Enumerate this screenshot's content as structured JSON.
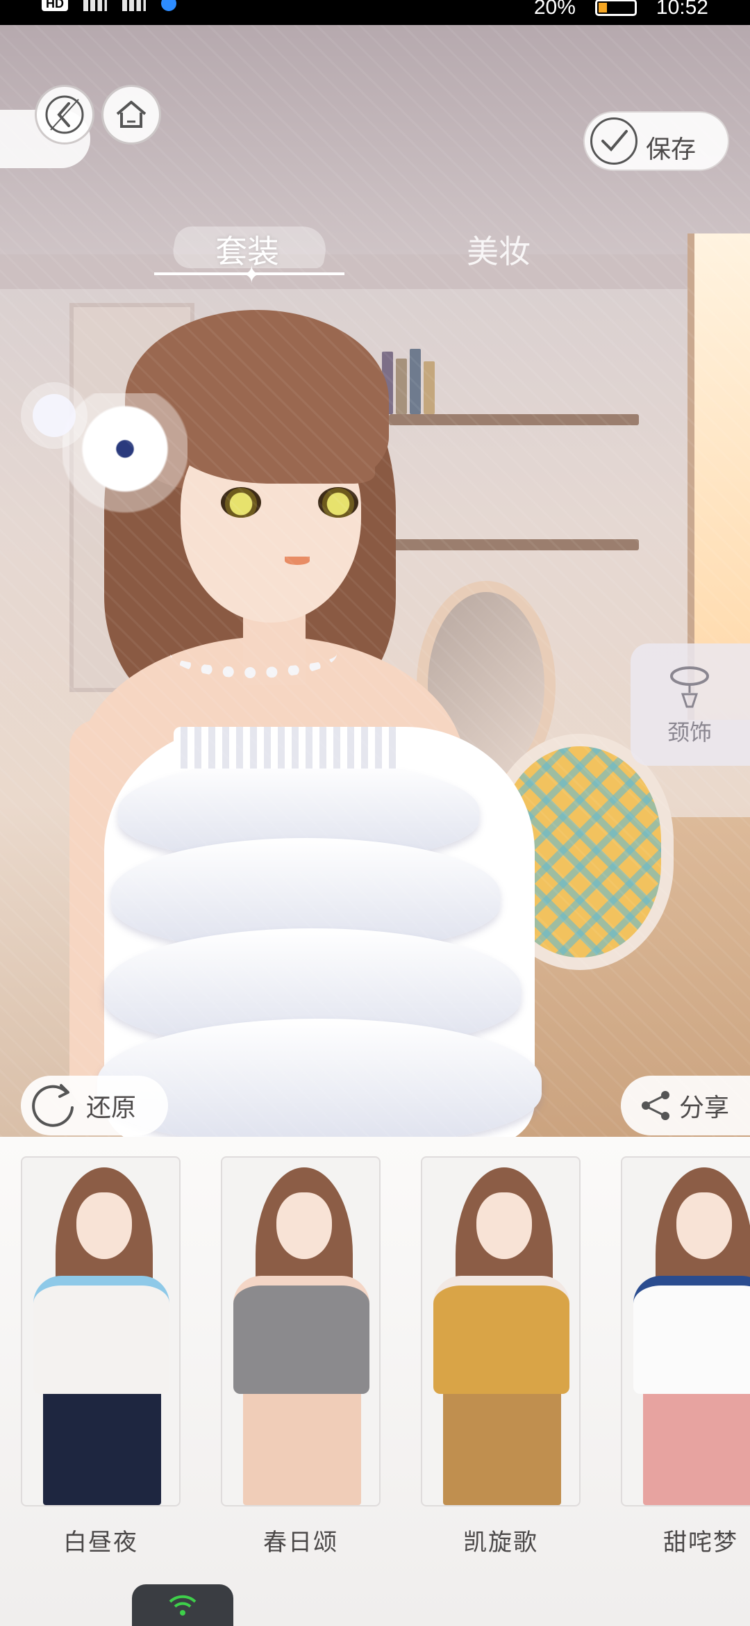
{
  "status_bar": {
    "left_chip": "HD",
    "battery_pct": "20%",
    "time": "10:52",
    "battery_color": "#f5a623"
  },
  "header": {
    "back_icon": "back-arrow-icon",
    "home_icon": "home-icon",
    "save_label": "保存",
    "save_icon": "checkmark-icon"
  },
  "tabs": [
    {
      "label": "套装",
      "active": true
    },
    {
      "label": "美妆",
      "active": false
    }
  ],
  "side_panel": {
    "category_label": "颈饰",
    "category_icon": "necklace-icon"
  },
  "actions": {
    "restore_label": "还原",
    "restore_icon": "refresh-icon",
    "share_label": "分享",
    "share_icon": "share-icon"
  },
  "outfits": [
    {
      "name": "白昼夜",
      "top_color": "#f4f2f0",
      "bottom_color": "#1e2640",
      "accent": "#8ec9e8"
    },
    {
      "name": "春日颂",
      "top_color": "#8b8a8d",
      "bottom_color": "#f0cdb8",
      "accent": "#f4d6c6"
    },
    {
      "name": "凯旋歌",
      "top_color": "#d9a447",
      "bottom_color": "#c08f4f",
      "accent": "#f2e8e3"
    },
    {
      "name": "甜咤梦",
      "top_color": "#fbfbfb",
      "bottom_color": "#e7a3a0",
      "accent": "#2a4c8f"
    }
  ],
  "nav_indicator": {
    "icon": "wifi-icon",
    "color": "#3ecf4a"
  }
}
